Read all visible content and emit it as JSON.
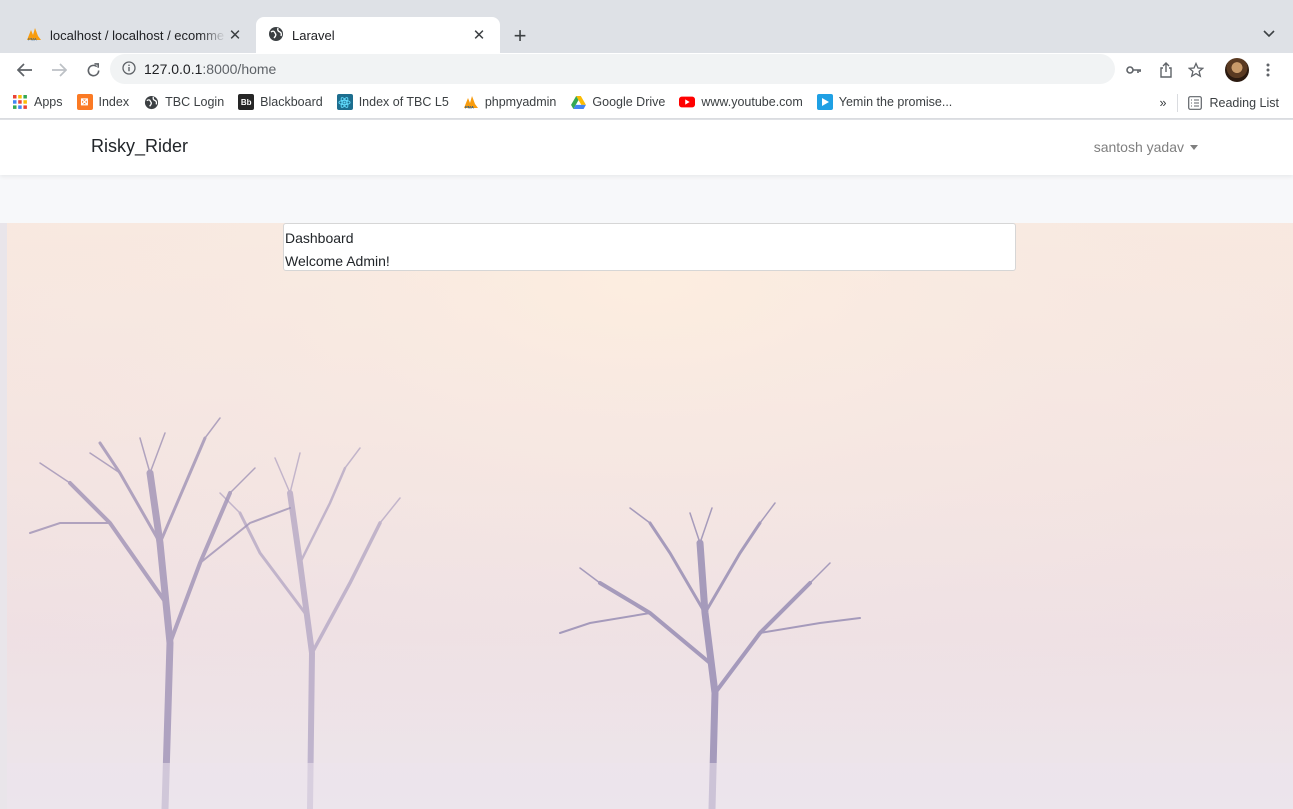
{
  "browser": {
    "tabs": [
      {
        "title": "localhost / localhost / ecomme",
        "icon": "phpmyadmin-icon",
        "active": false
      },
      {
        "title": "Laravel",
        "icon": "globe-icon",
        "active": true
      }
    ],
    "address": {
      "host": "127.0.0.1",
      "path": ":8000/home"
    },
    "bookmarks": [
      {
        "label": "Apps",
        "icon": "apps-grid-icon",
        "color": "#ea4335"
      },
      {
        "label": "Index",
        "icon": "xampp-icon",
        "color": "#fb7a24"
      },
      {
        "label": "TBC Login",
        "icon": "globe-icon",
        "color": "#3c4043"
      },
      {
        "label": "Blackboard",
        "icon": "blackboard-icon",
        "color": "#262626"
      },
      {
        "label": "Index of TBC L5",
        "icon": "react-icon",
        "color": "#1d6e8f"
      },
      {
        "label": "phpmyadmin",
        "icon": "phpmyadmin-icon",
        "color": "#f89c0e"
      },
      {
        "label": "Google Drive",
        "icon": "google-drive-icon",
        "color": "#34a853"
      },
      {
        "label": "www.youtube.com",
        "icon": "youtube-icon",
        "color": "#ff0000"
      },
      {
        "label": "Yemin the promise...",
        "icon": "play-icon",
        "color": "#1fa0e4"
      }
    ],
    "overflow_label": "»",
    "reading_list_label": "Reading List"
  },
  "app": {
    "brand": "Risky_Rider",
    "user_name": "santosh yadav"
  },
  "card": {
    "header": "Dashboard",
    "body": "Welcome Admin!"
  }
}
